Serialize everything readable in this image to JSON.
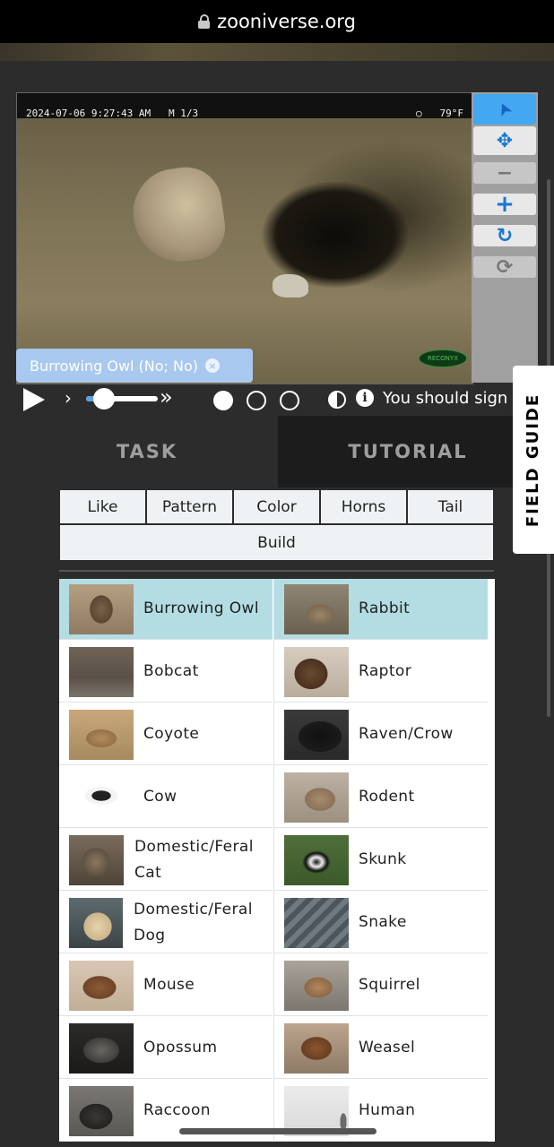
{
  "browser": {
    "url": "zooniverse.org"
  },
  "viewer": {
    "timestamp": "2024-07-06 9:27:43 AM",
    "camera": "M 1/3",
    "moon_icon": "○",
    "temperature": "79°F",
    "watermark": "RECONYX",
    "annotation_tag": "Burrowing Owl (No; No)",
    "close_glyph": "×"
  },
  "toolbar": {
    "icons": [
      "pointer-icon",
      "move-icon",
      "zoom-out-icon",
      "zoom-in-icon",
      "rotate-icon",
      "reset-icon"
    ],
    "glyphs": {
      "pointer": "➤",
      "move": "✥",
      "zoom_out": "−",
      "zoom_in": "+",
      "rotate": "↻",
      "reset": "⟳"
    }
  },
  "playback": {
    "forward_glyph": "›",
    "fast_forward_glyph": "»",
    "speed_level": 0.25,
    "frames": 3,
    "current_frame": 1,
    "info_glyph": "i",
    "sign_in_text": "You should sign in"
  },
  "tabs": {
    "task": "TASK",
    "tutorial": "TUTORIAL"
  },
  "field_guide": "FIELD GUIDE",
  "filters": {
    "row1": [
      "Like",
      "Pattern",
      "Color",
      "Horns",
      "Tail"
    ],
    "row2": [
      "Build"
    ]
  },
  "species": [
    {
      "name": "Burrowing Owl",
      "selected": true
    },
    {
      "name": "Rabbit",
      "selected": true
    },
    {
      "name": "Bobcat",
      "selected": false
    },
    {
      "name": "Raptor",
      "selected": false
    },
    {
      "name": "Coyote",
      "selected": false
    },
    {
      "name": "Raven/Crow",
      "selected": false
    },
    {
      "name": "Cow",
      "selected": false
    },
    {
      "name": "Rodent",
      "selected": false
    },
    {
      "name": "Domestic/Feral Cat",
      "selected": false
    },
    {
      "name": "Skunk",
      "selected": false
    },
    {
      "name": "Domestic/Feral Dog",
      "selected": false
    },
    {
      "name": "Snake",
      "selected": false
    },
    {
      "name": "Mouse",
      "selected": false
    },
    {
      "name": "Squirrel",
      "selected": false
    },
    {
      "name": "Opossum",
      "selected": false
    },
    {
      "name": "Weasel",
      "selected": false
    },
    {
      "name": "Raccoon",
      "selected": false
    },
    {
      "name": "Human",
      "selected": false
    }
  ],
  "colors": {
    "selected_row": "#b3dde3",
    "tag_bg": "#a8c8ef",
    "tool_active": "#43a7f2",
    "icon_blue": "#1976d2"
  }
}
